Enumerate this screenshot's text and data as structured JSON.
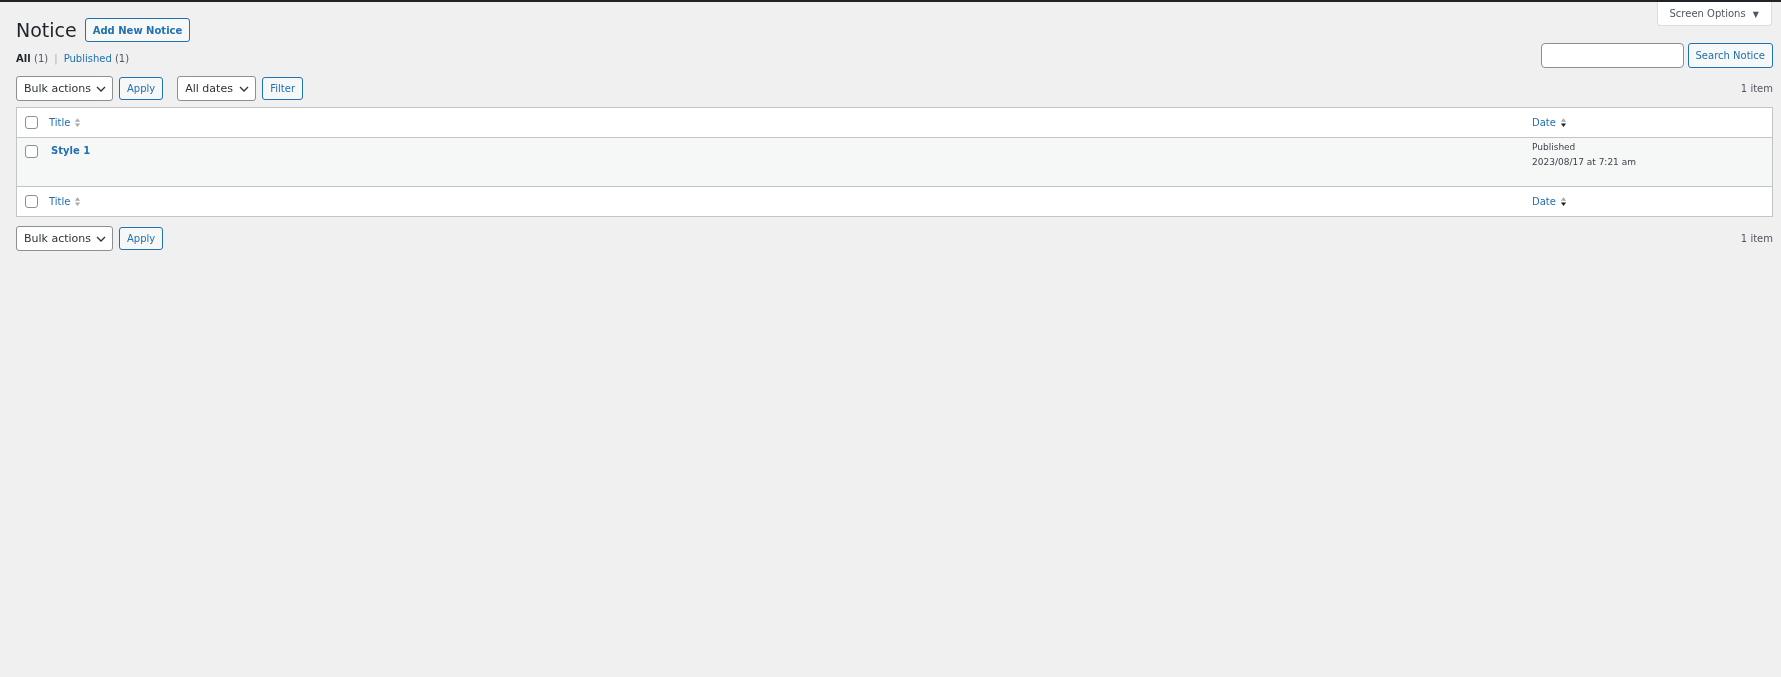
{
  "screen_options": {
    "label": "Screen Options",
    "caret": "▼"
  },
  "heading": {
    "title": "Notice",
    "add_button": "Add New Notice"
  },
  "views": [
    {
      "label": "All",
      "count": "(1)",
      "selected": true
    },
    {
      "label": "Published",
      "count": "(1)",
      "selected": false
    }
  ],
  "views_separator": "|",
  "search": {
    "button": "Search Notice"
  },
  "top_nav": {
    "bulk_actions": "Bulk actions",
    "apply": "Apply",
    "date_filter": "All dates",
    "filter": "Filter",
    "count": "1 item"
  },
  "table": {
    "header_checked": false,
    "footer_checked": false,
    "columns": [
      {
        "label": "Title",
        "sorted": false
      },
      {
        "label": "Date",
        "sorted": true
      }
    ],
    "rows": [
      {
        "checked": false,
        "title": "Style 1",
        "status": "Published",
        "date": "2023/08/17 at 7:21 am"
      }
    ],
    "footer_columns": [
      {
        "label": "Title",
        "sorted": false
      },
      {
        "label": "Date",
        "sorted": true
      }
    ]
  },
  "bottom_nav": {
    "bulk_actions": "Bulk actions",
    "apply": "Apply",
    "count": "1 item"
  }
}
